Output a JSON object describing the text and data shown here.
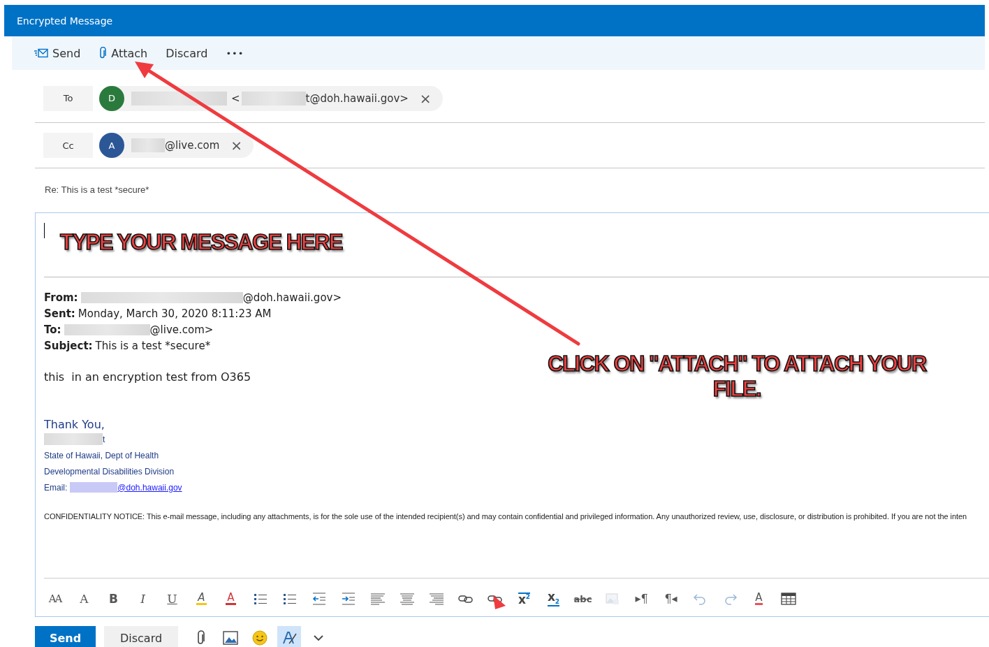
{
  "window": {
    "title": "Encrypted Message"
  },
  "command_bar": [
    {
      "kind": "send",
      "label": "Send"
    },
    {
      "kind": "attach",
      "label": "Attach"
    },
    {
      "kind": "discard",
      "label": "Discard"
    },
    {
      "kind": "more",
      "label": "•••"
    }
  ],
  "recipients": [
    {
      "field": "To",
      "initial": "D",
      "color": "#2b7a3d",
      "open_bracket": "<",
      "address": "t@doh.hawaii.gov>"
    },
    {
      "field": "Cc",
      "initial": "A",
      "color": "#2b5797",
      "address": "@live.com"
    }
  ],
  "remove_glyph": "×",
  "subject": "Re: This is a test *secure*",
  "annotations": [
    {
      "text": "TYPE YOUR MESSAGE HERE"
    },
    {
      "text": "CLICK ON \"ATTACH\" TO ATTACH YOUR FILE."
    }
  ],
  "quoted_header": [
    {
      "label": "From:",
      "redacted": true,
      "value": "@doh.hawaii.gov>"
    },
    {
      "label": "Sent:",
      "redacted": false,
      "value": "Monday, March 30, 2020 8:11:23 AM"
    },
    {
      "label": "To:",
      "redacted": true,
      "value": "@live.com>"
    },
    {
      "label": "Subject:",
      "redacted": false,
      "value": "This is a test *secure*"
    }
  ],
  "body": "this  in an encryption test from O365",
  "signature": {
    "closing": "Thank You,",
    "name_tail": "t",
    "lines": [
      "State of Hawaii, Dept of Health",
      "Developmental Disabilities Division"
    ],
    "email_label": "Email:",
    "email_link": "@doh.hawaii.gov"
  },
  "confidentiality": "CONFIDENTIALITY NOTICE: This e-mail message, including any attachments, is for the sole use of the intended recipient(s) and may contain confidential and privileged information. Any unauthorized review, use, disclosure, or distribution is prohibited. If you are not the inten",
  "format_toolbar": [
    {
      "kind": "font-size",
      "glyph": "AA"
    },
    {
      "kind": "grow-font",
      "glyph": "A"
    },
    {
      "kind": "bold",
      "glyph": "B"
    },
    {
      "kind": "italic",
      "glyph": "I"
    },
    {
      "kind": "underline",
      "glyph": "U"
    },
    {
      "kind": "highlight",
      "glyph": "A"
    },
    {
      "kind": "font-color",
      "glyph": "A"
    },
    {
      "kind": "bullets"
    },
    {
      "kind": "numbering"
    },
    {
      "kind": "outdent"
    },
    {
      "kind": "indent"
    },
    {
      "kind": "align-left"
    },
    {
      "kind": "align-center"
    },
    {
      "kind": "align-right"
    },
    {
      "kind": "link"
    },
    {
      "kind": "unlink"
    },
    {
      "kind": "superscript",
      "glyph": "x",
      "small": "2"
    },
    {
      "kind": "subscript",
      "glyph": "x",
      "small": "2"
    },
    {
      "kind": "strikethrough",
      "glyph": "abc"
    },
    {
      "kind": "image",
      "disabled": true
    },
    {
      "kind": "ltr",
      "glyph": "▸¶"
    },
    {
      "kind": "rtl",
      "glyph": "¶◂"
    },
    {
      "kind": "undo"
    },
    {
      "kind": "redo"
    },
    {
      "kind": "clear-format",
      "glyph": "A"
    },
    {
      "kind": "table"
    }
  ],
  "footer": {
    "send": "Send",
    "discard": "Discard",
    "tools": [
      {
        "kind": "attach",
        "selected": false
      },
      {
        "kind": "picture",
        "selected": false
      },
      {
        "kind": "emoji",
        "selected": false
      },
      {
        "kind": "spelling",
        "selected": true
      },
      {
        "kind": "chevron",
        "selected": false
      }
    ]
  }
}
